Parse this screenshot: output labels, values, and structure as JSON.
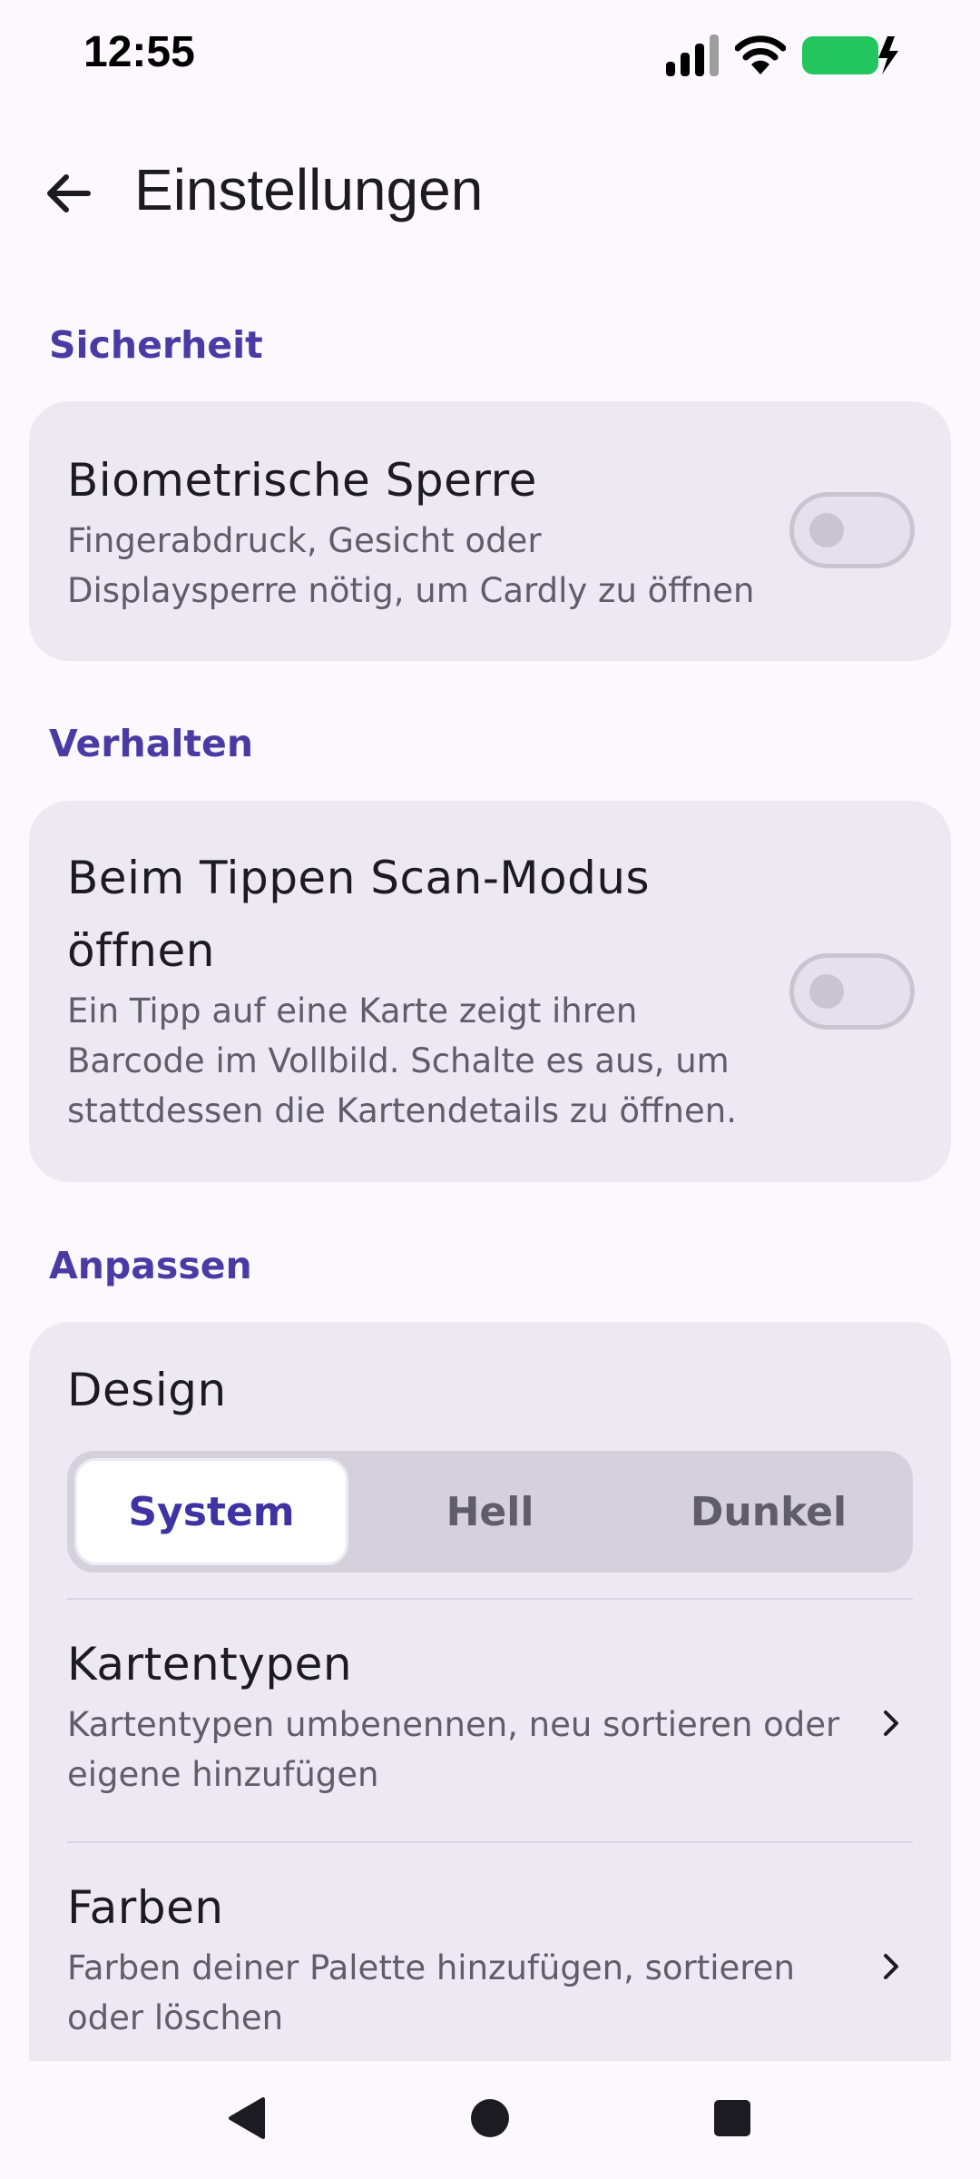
{
  "status_bar": {
    "time": "12:55"
  },
  "app_bar": {
    "title": "Einstellungen"
  },
  "sections": {
    "security": {
      "header": "Sicherheit",
      "biometric": {
        "title": "Biometrische Sperre",
        "subtitle_line1": "Fingerabdruck, Gesicht oder",
        "subtitle_line2": "Displaysperre nötig, um Cardly zu öffnen",
        "enabled": false
      }
    },
    "behavior": {
      "header": "Verhalten",
      "scan_mode": {
        "title_line1": "Beim Tippen Scan-Modus",
        "title_line2": "öffnen",
        "subtitle_line1": "Ein Tipp auf eine Karte zeigt ihren",
        "subtitle_line2": "Barcode im Vollbild. Schalte es aus, um",
        "subtitle_line3": "stattdessen die Kartendetails zu öffnen.",
        "enabled": false
      }
    },
    "customize": {
      "header": "Anpassen",
      "design": {
        "title": "Design",
        "options": [
          "System",
          "Hell",
          "Dunkel"
        ],
        "selected": "System"
      },
      "card_types": {
        "title": "Kartentypen",
        "subtitle_line1": "Kartentypen umbenennen, neu sortieren oder",
        "subtitle_line2": "eigene hinzufügen"
      },
      "colors": {
        "title": "Farben",
        "subtitle_line1": "Farben deiner Palette hinzufügen, sortieren",
        "subtitle_line2": "oder löschen"
      }
    }
  },
  "icons": {
    "back": "arrow-back-icon",
    "chevron": "chevron-right-icon",
    "signal": "cellular-signal-icon",
    "wifi": "wifi-icon",
    "battery": "battery-charging-icon"
  },
  "colors": {
    "accent": "#4A3BA4",
    "card_background": "#ECE9F3",
    "page_background": "#FCF8FD",
    "battery": "#22C55E"
  }
}
